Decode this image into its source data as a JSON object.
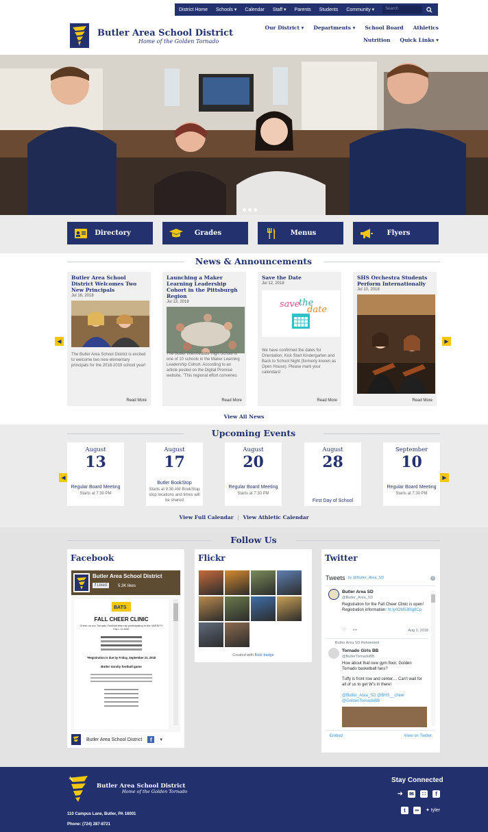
{
  "utility_nav": {
    "items": [
      "District Home",
      "Schools ▾",
      "Calendar",
      "Staff ▾",
      "Parents",
      "Students",
      "Community ▾"
    ],
    "search_placeholder": "Search"
  },
  "header": {
    "title": "Butler Area School District",
    "tagline": "Home of the Golden Tornado",
    "nav_row1": [
      "Our District ▾",
      "Departments ▾",
      "School Board",
      "Athletics"
    ],
    "nav_row2": [
      "Nutrition",
      "Quick Links ▾"
    ]
  },
  "quick_links": [
    {
      "label": "Directory",
      "icon": "id-card-icon"
    },
    {
      "label": "Grades",
      "icon": "graduation-cap-icon"
    },
    {
      "label": "Menus",
      "icon": "utensils-icon"
    },
    {
      "label": "Flyers",
      "icon": "megaphone-icon"
    }
  ],
  "news": {
    "heading": "News & Announcements",
    "view_all": "View All News",
    "items": [
      {
        "title": "Butler Area School District Welcomes Two New Principals",
        "date": "Jul 16, 2018",
        "excerpt": "The Butler Area School District is excited to welcome two new elementary principals for the 2018-2019 school year!",
        "read_more": "Read More"
      },
      {
        "title": "Launching a Maker Learning Leadership Cohort in the Pittsburgh Region",
        "date": "Jul 13, 2018",
        "excerpt": "The Butler Intermediate High School is one of 10 schools in the Maker Learning Leadership Cohort. According to an article posted on the Digital Promise website, \"This regional effort convenes",
        "read_more": "Read More"
      },
      {
        "title": "Save the Date",
        "date": "Jul 12, 2018",
        "excerpt": "We have confirmed the dates for Orientation, Kick Start Kindergarten and Back to School Night (formerly known as Open House). Please mark your calendars!",
        "read_more": "Read More"
      },
      {
        "title": "SHS Orchestra Students Perform Internationally",
        "date": "Jul 10, 2018",
        "excerpt": "",
        "read_more": "Read More"
      }
    ]
  },
  "events": {
    "heading": "Upcoming Events",
    "full_calendar": "View Full Calendar",
    "separator": "|",
    "athletic_calendar": "View Athletic Calendar",
    "items": [
      {
        "month": "August",
        "day": "13",
        "title": "Regular Board Meeting",
        "detail": "Starts at 7:30 PM"
      },
      {
        "month": "August",
        "day": "17",
        "title": "Butler BookStop",
        "detail": "Starts at 9:30 AM BookStop stop locations and times will be shared"
      },
      {
        "month": "August",
        "day": "20",
        "title": "Regular Board Meeting",
        "detail": "Starts at 7:30 PM"
      },
      {
        "month": "August",
        "day": "28",
        "title": "First Day of School",
        "detail": ""
      },
      {
        "month": "September",
        "day": "10",
        "title": "Regular Board Meeting",
        "detail": "Starts at 7:30 PM"
      }
    ]
  },
  "follow": {
    "heading": "Follow Us",
    "facebook": {
      "title": "Facebook",
      "page_name": "Butler Area School District",
      "like": "Liked",
      "likes_count": "5.3K likes",
      "flyer_title": "FALL CHEER CLINIC",
      "flyer_subtitle": "Cheer on our Tornado Football team by participating in the VARSITY FALL CLINIC",
      "flyer_deadline": "*Registration is due by Friday, September 21, 2018",
      "flyer_game": "Butler Varsity football game",
      "footer_name": "Butler Area School District"
    },
    "flickr": {
      "title": "Flickr",
      "caption_prefix": "Created with",
      "caption_link": "flickr badge"
    },
    "twitter": {
      "title": "Twitter",
      "tweets_label": "Tweets",
      "by": "by @Butler_Area_SD",
      "tweet1": {
        "name": "Butler Area SD",
        "handle": "@Butler_Area_SD",
        "text": "Registration for the Fall Cheer Clinic is open! Registration information:",
        "link": "ht.ly/lOM530lg9Cp",
        "date": "Aug 3, 2018"
      },
      "retweet_label": "Butler Area SD Retweeted",
      "tweet2": {
        "name": "Tornado Girls BB",
        "handle": "@ButlerTornadoBB",
        "text": "How about that new gym floor, Golden Tornado basketball fans?",
        "text2": "Tuffy is front row and center.... Can't wait for all of us to get W's in there!",
        "mentions": "@Butler_Area_SD @BHS__cheer @GoldenTornadoBB"
      },
      "embed": "Embed",
      "view": "View on Twitter"
    }
  },
  "footer": {
    "title": "Butler Area School District",
    "tagline": "Home of the Golden Tornado",
    "address": "110 Campus Lane, Butler, PA 16001",
    "phone_label": "Phone:",
    "phone": "(724) 287-8721",
    "stay_connected": "Stay Connected",
    "brand": "tyler"
  },
  "colors": {
    "navy": "#23326f",
    "gold": "#f4c70f"
  }
}
